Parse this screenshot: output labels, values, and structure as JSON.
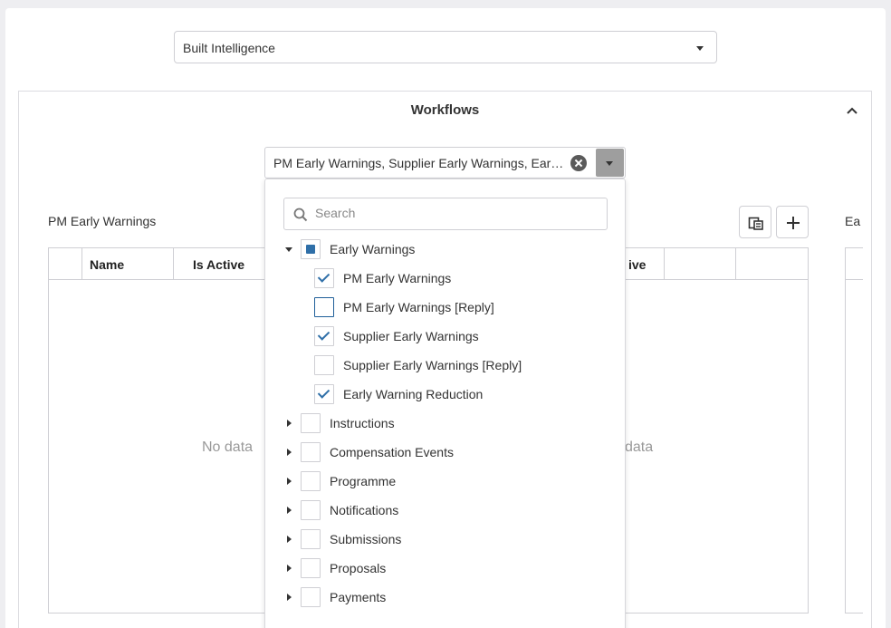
{
  "top_select": {
    "value": "Built Intelligence"
  },
  "workflows": {
    "title": "Workflows",
    "selected_text": "PM Early Warnings, Supplier Early Warnings, Early Warning Reduction",
    "search_placeholder": "Search"
  },
  "left_panel": {
    "title": "PM Early Warnings",
    "columns": [
      "Name",
      "Is Active"
    ],
    "empty_text": "No data"
  },
  "middle_visible": {
    "column_fragment": "ive",
    "empty_fragment": "data"
  },
  "right_panel": {
    "title_fragment": "Ea"
  },
  "tree": [
    {
      "label": "Early Warnings",
      "level": 0,
      "expanded": true,
      "state": "partial",
      "children": [
        {
          "label": "PM Early Warnings",
          "state": "checked"
        },
        {
          "label": "PM Early Warnings [Reply]",
          "state": "unchecked",
          "focused": true
        },
        {
          "label": "Supplier Early Warnings",
          "state": "checked"
        },
        {
          "label": "Supplier Early Warnings [Reply]",
          "state": "unchecked"
        },
        {
          "label": "Early Warning Reduction",
          "state": "checked"
        }
      ]
    },
    {
      "label": "Instructions",
      "level": 0,
      "expanded": false,
      "state": "unchecked"
    },
    {
      "label": "Compensation Events",
      "level": 0,
      "expanded": false,
      "state": "unchecked"
    },
    {
      "label": "Programme",
      "level": 0,
      "expanded": false,
      "state": "unchecked"
    },
    {
      "label": "Notifications",
      "level": 0,
      "expanded": false,
      "state": "unchecked"
    },
    {
      "label": "Submissions",
      "level": 0,
      "expanded": false,
      "state": "unchecked"
    },
    {
      "label": "Proposals",
      "level": 0,
      "expanded": false,
      "state": "unchecked"
    },
    {
      "label": "Payments",
      "level": 0,
      "expanded": false,
      "state": "unchecked"
    }
  ],
  "colors": {
    "accent": "#2f6fa8",
    "border": "#cfcfd4",
    "drop_button": "#9e9e9e"
  },
  "icons": [
    "chevron-down-icon",
    "chevron-up-icon",
    "clear-icon",
    "search-icon",
    "export-icon",
    "plus-icon",
    "check-icon"
  ]
}
